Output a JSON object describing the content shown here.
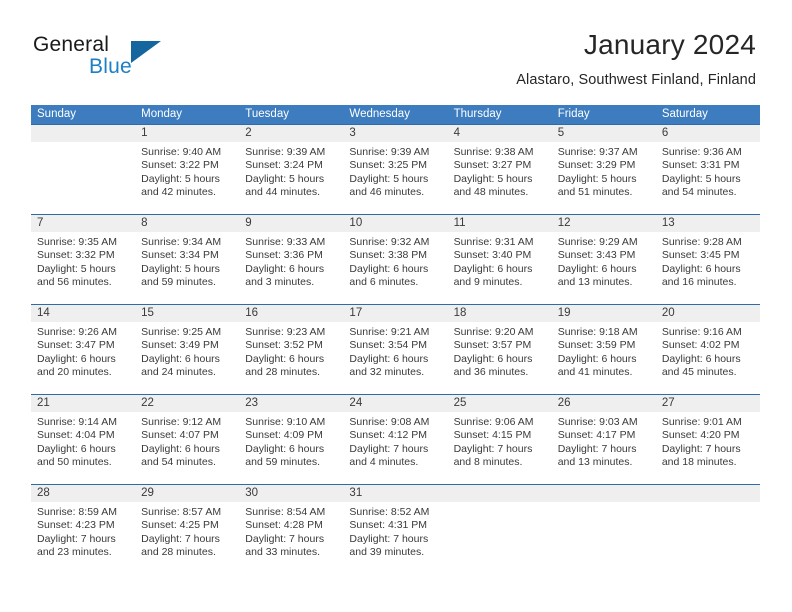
{
  "brand": {
    "name_top": "General",
    "name_bottom": "Blue",
    "accent_color": "#1f7fc4",
    "triangle_color": "#15659e"
  },
  "header": {
    "title": "January 2024",
    "subtitle": "Alastaro, Southwest Finland, Finland",
    "header_bg_color": "#3c7cbf",
    "daynum_band_color": "#efefef",
    "week_divider_color": "#2d6ca8"
  },
  "weekdays": [
    "Sunday",
    "Monday",
    "Tuesday",
    "Wednesday",
    "Thursday",
    "Friday",
    "Saturday"
  ],
  "weeks": [
    {
      "days": [
        {
          "num": "",
          "sunrise": "",
          "sunset": "",
          "daylight_1": "",
          "daylight_2": ""
        },
        {
          "num": "1",
          "sunrise": "Sunrise: 9:40 AM",
          "sunset": "Sunset: 3:22 PM",
          "daylight_1": "Daylight: 5 hours",
          "daylight_2": "and 42 minutes."
        },
        {
          "num": "2",
          "sunrise": "Sunrise: 9:39 AM",
          "sunset": "Sunset: 3:24 PM",
          "daylight_1": "Daylight: 5 hours",
          "daylight_2": "and 44 minutes."
        },
        {
          "num": "3",
          "sunrise": "Sunrise: 9:39 AM",
          "sunset": "Sunset: 3:25 PM",
          "daylight_1": "Daylight: 5 hours",
          "daylight_2": "and 46 minutes."
        },
        {
          "num": "4",
          "sunrise": "Sunrise: 9:38 AM",
          "sunset": "Sunset: 3:27 PM",
          "daylight_1": "Daylight: 5 hours",
          "daylight_2": "and 48 minutes."
        },
        {
          "num": "5",
          "sunrise": "Sunrise: 9:37 AM",
          "sunset": "Sunset: 3:29 PM",
          "daylight_1": "Daylight: 5 hours",
          "daylight_2": "and 51 minutes."
        },
        {
          "num": "6",
          "sunrise": "Sunrise: 9:36 AM",
          "sunset": "Sunset: 3:31 PM",
          "daylight_1": "Daylight: 5 hours",
          "daylight_2": "and 54 minutes."
        }
      ]
    },
    {
      "days": [
        {
          "num": "7",
          "sunrise": "Sunrise: 9:35 AM",
          "sunset": "Sunset: 3:32 PM",
          "daylight_1": "Daylight: 5 hours",
          "daylight_2": "and 56 minutes."
        },
        {
          "num": "8",
          "sunrise": "Sunrise: 9:34 AM",
          "sunset": "Sunset: 3:34 PM",
          "daylight_1": "Daylight: 5 hours",
          "daylight_2": "and 59 minutes."
        },
        {
          "num": "9",
          "sunrise": "Sunrise: 9:33 AM",
          "sunset": "Sunset: 3:36 PM",
          "daylight_1": "Daylight: 6 hours",
          "daylight_2": "and 3 minutes."
        },
        {
          "num": "10",
          "sunrise": "Sunrise: 9:32 AM",
          "sunset": "Sunset: 3:38 PM",
          "daylight_1": "Daylight: 6 hours",
          "daylight_2": "and 6 minutes."
        },
        {
          "num": "11",
          "sunrise": "Sunrise: 9:31 AM",
          "sunset": "Sunset: 3:40 PM",
          "daylight_1": "Daylight: 6 hours",
          "daylight_2": "and 9 minutes."
        },
        {
          "num": "12",
          "sunrise": "Sunrise: 9:29 AM",
          "sunset": "Sunset: 3:43 PM",
          "daylight_1": "Daylight: 6 hours",
          "daylight_2": "and 13 minutes."
        },
        {
          "num": "13",
          "sunrise": "Sunrise: 9:28 AM",
          "sunset": "Sunset: 3:45 PM",
          "daylight_1": "Daylight: 6 hours",
          "daylight_2": "and 16 minutes."
        }
      ]
    },
    {
      "days": [
        {
          "num": "14",
          "sunrise": "Sunrise: 9:26 AM",
          "sunset": "Sunset: 3:47 PM",
          "daylight_1": "Daylight: 6 hours",
          "daylight_2": "and 20 minutes."
        },
        {
          "num": "15",
          "sunrise": "Sunrise: 9:25 AM",
          "sunset": "Sunset: 3:49 PM",
          "daylight_1": "Daylight: 6 hours",
          "daylight_2": "and 24 minutes."
        },
        {
          "num": "16",
          "sunrise": "Sunrise: 9:23 AM",
          "sunset": "Sunset: 3:52 PM",
          "daylight_1": "Daylight: 6 hours",
          "daylight_2": "and 28 minutes."
        },
        {
          "num": "17",
          "sunrise": "Sunrise: 9:21 AM",
          "sunset": "Sunset: 3:54 PM",
          "daylight_1": "Daylight: 6 hours",
          "daylight_2": "and 32 minutes."
        },
        {
          "num": "18",
          "sunrise": "Sunrise: 9:20 AM",
          "sunset": "Sunset: 3:57 PM",
          "daylight_1": "Daylight: 6 hours",
          "daylight_2": "and 36 minutes."
        },
        {
          "num": "19",
          "sunrise": "Sunrise: 9:18 AM",
          "sunset": "Sunset: 3:59 PM",
          "daylight_1": "Daylight: 6 hours",
          "daylight_2": "and 41 minutes."
        },
        {
          "num": "20",
          "sunrise": "Sunrise: 9:16 AM",
          "sunset": "Sunset: 4:02 PM",
          "daylight_1": "Daylight: 6 hours",
          "daylight_2": "and 45 minutes."
        }
      ]
    },
    {
      "days": [
        {
          "num": "21",
          "sunrise": "Sunrise: 9:14 AM",
          "sunset": "Sunset: 4:04 PM",
          "daylight_1": "Daylight: 6 hours",
          "daylight_2": "and 50 minutes."
        },
        {
          "num": "22",
          "sunrise": "Sunrise: 9:12 AM",
          "sunset": "Sunset: 4:07 PM",
          "daylight_1": "Daylight: 6 hours",
          "daylight_2": "and 54 minutes."
        },
        {
          "num": "23",
          "sunrise": "Sunrise: 9:10 AM",
          "sunset": "Sunset: 4:09 PM",
          "daylight_1": "Daylight: 6 hours",
          "daylight_2": "and 59 minutes."
        },
        {
          "num": "24",
          "sunrise": "Sunrise: 9:08 AM",
          "sunset": "Sunset: 4:12 PM",
          "daylight_1": "Daylight: 7 hours",
          "daylight_2": "and 4 minutes."
        },
        {
          "num": "25",
          "sunrise": "Sunrise: 9:06 AM",
          "sunset": "Sunset: 4:15 PM",
          "daylight_1": "Daylight: 7 hours",
          "daylight_2": "and 8 minutes."
        },
        {
          "num": "26",
          "sunrise": "Sunrise: 9:03 AM",
          "sunset": "Sunset: 4:17 PM",
          "daylight_1": "Daylight: 7 hours",
          "daylight_2": "and 13 minutes."
        },
        {
          "num": "27",
          "sunrise": "Sunrise: 9:01 AM",
          "sunset": "Sunset: 4:20 PM",
          "daylight_1": "Daylight: 7 hours",
          "daylight_2": "and 18 minutes."
        }
      ]
    },
    {
      "days": [
        {
          "num": "28",
          "sunrise": "Sunrise: 8:59 AM",
          "sunset": "Sunset: 4:23 PM",
          "daylight_1": "Daylight: 7 hours",
          "daylight_2": "and 23 minutes."
        },
        {
          "num": "29",
          "sunrise": "Sunrise: 8:57 AM",
          "sunset": "Sunset: 4:25 PM",
          "daylight_1": "Daylight: 7 hours",
          "daylight_2": "and 28 minutes."
        },
        {
          "num": "30",
          "sunrise": "Sunrise: 8:54 AM",
          "sunset": "Sunset: 4:28 PM",
          "daylight_1": "Daylight: 7 hours",
          "daylight_2": "and 33 minutes."
        },
        {
          "num": "31",
          "sunrise": "Sunrise: 8:52 AM",
          "sunset": "Sunset: 4:31 PM",
          "daylight_1": "Daylight: 7 hours",
          "daylight_2": "and 39 minutes."
        },
        {
          "num": "",
          "sunrise": "",
          "sunset": "",
          "daylight_1": "",
          "daylight_2": ""
        },
        {
          "num": "",
          "sunrise": "",
          "sunset": "",
          "daylight_1": "",
          "daylight_2": ""
        },
        {
          "num": "",
          "sunrise": "",
          "sunset": "",
          "daylight_1": "",
          "daylight_2": ""
        }
      ]
    }
  ]
}
